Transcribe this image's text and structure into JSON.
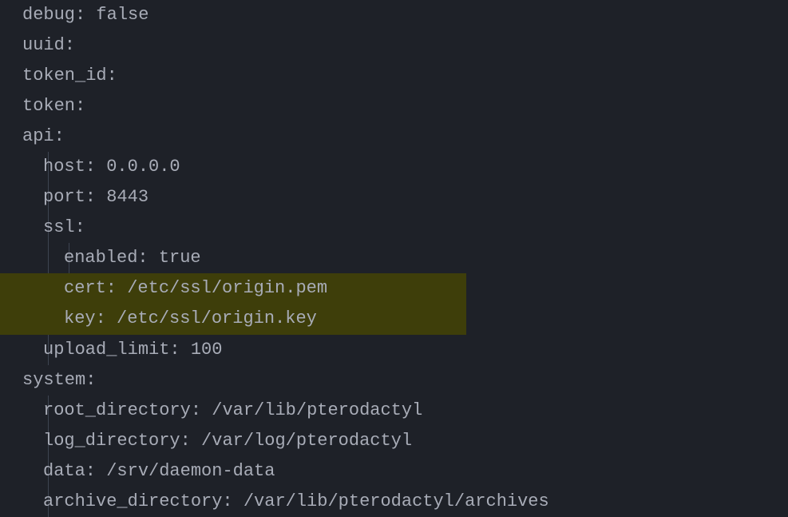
{
  "yaml": {
    "debug_key": "debug:",
    "debug_value": " false",
    "uuid_key": "uuid:",
    "token_id_key": "token_id:",
    "token_key": "token:",
    "api_key": "api:",
    "api": {
      "host_key": "host:",
      "host_value": " 0.0.0.0",
      "port_key": "port:",
      "port_value": " 8443",
      "ssl_key": "ssl:",
      "ssl": {
        "enabled_key": "enabled:",
        "enabled_value": " true",
        "cert_key": "cert:",
        "cert_value": " /etc/ssl/origin.pem",
        "key_key": "key:",
        "key_value": " /etc/ssl/origin.key"
      },
      "upload_limit_key": "upload_limit:",
      "upload_limit_value": " 100"
    },
    "system_key": "system:",
    "system": {
      "root_directory_key": "root_directory:",
      "root_directory_value": " /var/lib/pterodactyl",
      "log_directory_key": "log_directory:",
      "log_directory_value": " /var/log/pterodactyl",
      "data_key": "data:",
      "data_value": " /srv/daemon-data",
      "archive_directory_key": "archive_directory:",
      "archive_directory_value": " /var/lib/pterodactyl/archives"
    }
  }
}
